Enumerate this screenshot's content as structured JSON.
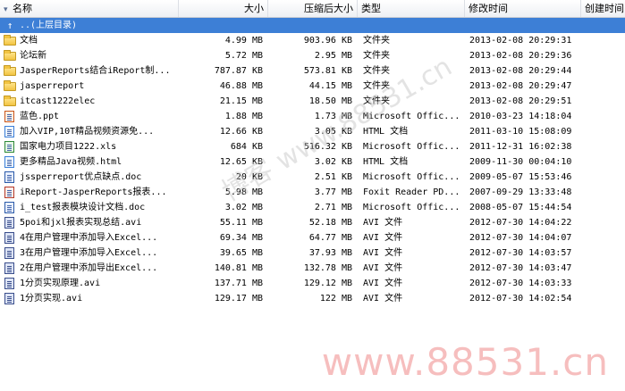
{
  "columns": {
    "name": "名称",
    "size": "大小",
    "compressed": "压缩后大小",
    "type": "类型",
    "modified": "修改时间",
    "created": "创建时间"
  },
  "rows": [
    {
      "icon": "folder-up-icon",
      "name": "..(上层目录)",
      "size": "",
      "compressed": "",
      "type": "",
      "modified": ""
    },
    {
      "icon": "folder-icon",
      "name": "文档",
      "size": "4.99 MB",
      "compressed": "903.96 KB",
      "type": "文件夹",
      "modified": "2013-02-08 20:29:31"
    },
    {
      "icon": "folder-icon",
      "name": "论坛新",
      "size": "5.72 MB",
      "compressed": "2.95 MB",
      "type": "文件夹",
      "modified": "2013-02-08 20:29:36"
    },
    {
      "icon": "folder-icon",
      "name": "JasperReports结合iReport制...",
      "size": "787.87 KB",
      "compressed": "573.81 KB",
      "type": "文件夹",
      "modified": "2013-02-08 20:29:44"
    },
    {
      "icon": "folder-icon",
      "name": "jasperreport",
      "size": "46.88 MB",
      "compressed": "44.15 MB",
      "type": "文件夹",
      "modified": "2013-02-08 20:29:47"
    },
    {
      "icon": "folder-icon",
      "name": "itcast1222elec",
      "size": "21.15 MB",
      "compressed": "18.50 MB",
      "type": "文件夹",
      "modified": "2013-02-08 20:29:51"
    },
    {
      "icon": "ppt-file-icon",
      "name": "蓝色.ppt",
      "size": "1.88 MB",
      "compressed": "1.73 MB",
      "type": "Microsoft Offic...",
      "modified": "2010-03-23 14:18:04"
    },
    {
      "icon": "html-file-icon",
      "name": "加入VIP,10T精品视频资源免...",
      "size": "12.66 KB",
      "compressed": "3.05 KB",
      "type": "HTML 文档",
      "modified": "2011-03-10 15:08:09"
    },
    {
      "icon": "xls-file-icon",
      "name": "国家电力项目1222.xls",
      "size": "684 KB",
      "compressed": "516.32 KB",
      "type": "Microsoft Offic...",
      "modified": "2011-12-31 16:02:38"
    },
    {
      "icon": "html-file-icon",
      "name": "更多精品Java视频.html",
      "size": "12.65 KB",
      "compressed": "3.02 KB",
      "type": "HTML 文档",
      "modified": "2009-11-30 00:04:10"
    },
    {
      "icon": "word-file-icon",
      "name": "jssperreport优点缺点.doc",
      "size": "20 KB",
      "compressed": "2.51 KB",
      "type": "Microsoft Offic...",
      "modified": "2009-05-07 15:53:46"
    },
    {
      "icon": "pdf-file-icon",
      "name": "iReport-JasperReports报表...",
      "size": "5.98 MB",
      "compressed": "3.77 MB",
      "type": "Foxit Reader PD...",
      "modified": "2007-09-29 13:33:48"
    },
    {
      "icon": "word-file-icon",
      "name": "i_test报表模块设计文档.doc",
      "size": "3.02 MB",
      "compressed": "2.71 MB",
      "type": "Microsoft Offic...",
      "modified": "2008-05-07 15:44:54"
    },
    {
      "icon": "avi-file-icon",
      "name": "5poi和jxl报表实现总结.avi",
      "size": "55.11 MB",
      "compressed": "52.18 MB",
      "type": "AVI 文件",
      "modified": "2012-07-30 14:04:22"
    },
    {
      "icon": "avi-file-icon",
      "name": "4在用户管理中添加导入Excel...",
      "size": "69.34 MB",
      "compressed": "64.77 MB",
      "type": "AVI 文件",
      "modified": "2012-07-30 14:04:07"
    },
    {
      "icon": "avi-file-icon",
      "name": "3在用户管理中添加导入Excel...",
      "size": "39.65 MB",
      "compressed": "37.93 MB",
      "type": "AVI 文件",
      "modified": "2012-07-30 14:03:57"
    },
    {
      "icon": "avi-file-icon",
      "name": "2在用户管理中添加导出Excel...",
      "size": "140.81 MB",
      "compressed": "132.78 MB",
      "type": "AVI 文件",
      "modified": "2012-07-30 14:03:47"
    },
    {
      "icon": "avi-file-icon",
      "name": "1分页实现原理.avi",
      "size": "137.71 MB",
      "compressed": "129.12 MB",
      "type": "AVI 文件",
      "modified": "2012-07-30 14:03:33"
    },
    {
      "icon": "avi-file-icon",
      "name": "1分页实现.avi",
      "size": "129.17 MB",
      "compressed": "122 MB",
      "type": "AVI 文件",
      "modified": "2012-07-30 14:02:54"
    }
  ],
  "watermark": "www.88531.cn",
  "watermark_diag": "博客 www.88531.cn",
  "colors": {
    "selection": "#3d7fd6",
    "watermark": "#f08a8a"
  }
}
